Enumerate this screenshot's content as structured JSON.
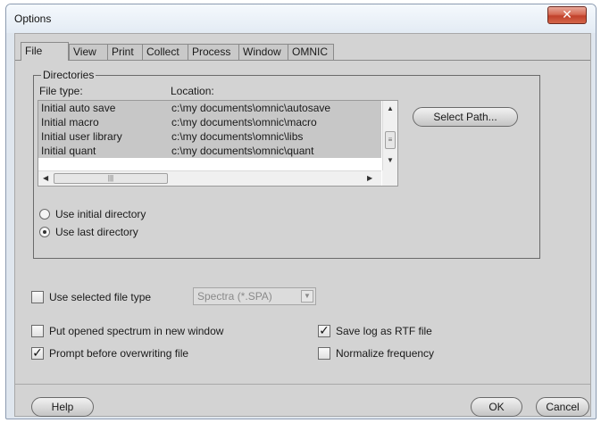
{
  "window": {
    "title": "Options",
    "close_glyph": "✕"
  },
  "tabs": [
    "File",
    "View",
    "Print",
    "Collect",
    "Process",
    "Window",
    "OMNIC"
  ],
  "active_tab": "File",
  "directories": {
    "group_label": "Directories",
    "col_file_type": "File type:",
    "col_location": "Location:",
    "rows": [
      {
        "file_type": "Initial auto save",
        "location": "c:\\my documents\\omnic\\autosave"
      },
      {
        "file_type": "Initial macro",
        "location": "c:\\my documents\\omnic\\macro"
      },
      {
        "file_type": "Initial user library",
        "location": "c:\\my documents\\omnic\\libs"
      },
      {
        "file_type": "Initial quant",
        "location": "c:\\my documents\\omnic\\quant"
      }
    ],
    "select_path_label": "Select Path...",
    "radio_initial": "Use initial directory",
    "radio_last": "Use last directory",
    "selected_radio": "last"
  },
  "options": {
    "use_selected_file_type": {
      "label": "Use selected file type",
      "checked": false
    },
    "file_type_select": {
      "value": "Spectra (*.SPA)",
      "enabled": false
    },
    "put_opened_spectrum": {
      "label": "Put opened spectrum in new window",
      "checked": false
    },
    "prompt_before_overwriting": {
      "label": "Prompt before overwriting file",
      "checked": true
    },
    "save_log_rtf": {
      "label": "Save log as RTF file",
      "checked": true
    },
    "normalize_frequency": {
      "label": "Normalize frequency",
      "checked": false
    }
  },
  "buttons": {
    "help": "Help",
    "ok": "OK",
    "cancel": "Cancel"
  },
  "glyphs": {
    "check": "✓",
    "up": "▲",
    "down": "▼",
    "left": "◀",
    "right": "▶",
    "grip_v": "≡",
    "grip_h": "|||",
    "drop": "▼"
  }
}
